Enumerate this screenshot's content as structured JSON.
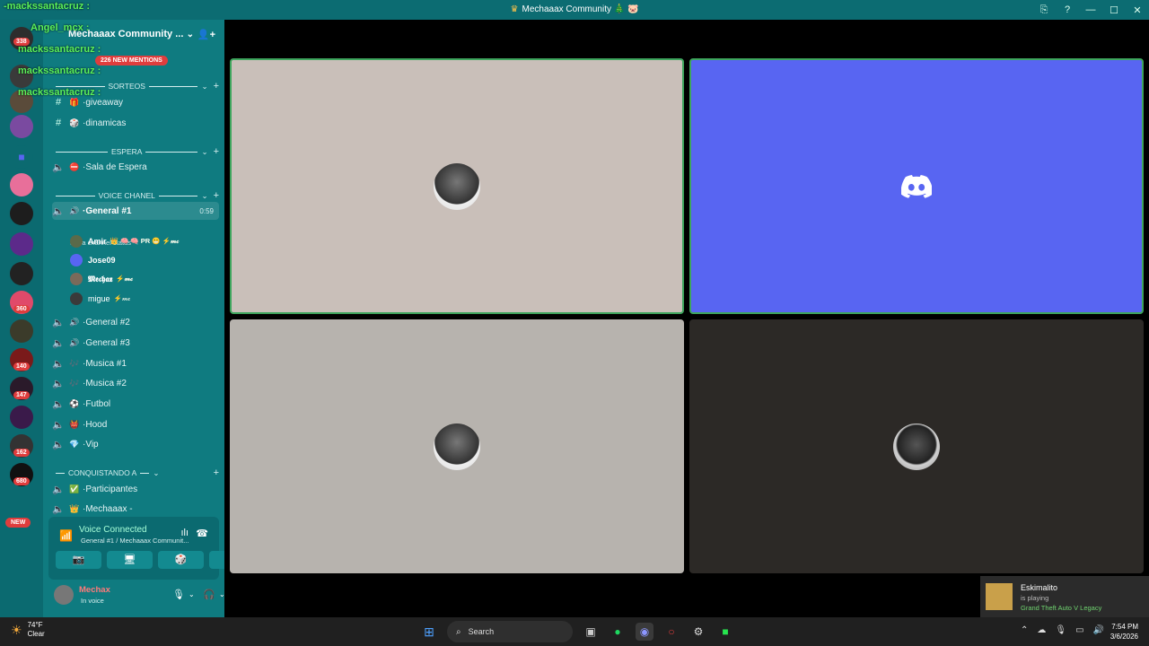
{
  "window": {
    "title": "Mechaaax Community",
    "title_emojis": "🎄 🐷",
    "controls": [
      "⎘",
      "?",
      "—",
      "☐",
      "✕"
    ]
  },
  "stream_overlay": {
    "lines": [
      "-mackssantacruz :",
      "Angel_mcx :",
      "mackssantacruz :",
      "mackssantacruz :",
      "mackssantacruz :"
    ]
  },
  "server": {
    "name": "Mechaaax Community ...",
    "mentions": "226 NEW MENTIONS"
  },
  "rail": {
    "badges": [
      "338",
      "360",
      "140",
      "147",
      "162",
      "680"
    ],
    "new_label": "NEW"
  },
  "categories": [
    {
      "name": "SORTEOS"
    },
    {
      "name": "ESPERA"
    },
    {
      "name": "VOICE CHANEL"
    },
    {
      "name": "CONQUISTANDO A"
    }
  ],
  "text_channels": [
    {
      "name": "giveaway",
      "emoji": "🎁"
    },
    {
      "name": "dinamicas",
      "emoji": "🎲"
    }
  ],
  "voice_channels": [
    {
      "name": "Sala de Espera",
      "emoji": "⛔"
    },
    {
      "name": "General #1",
      "emoji": "🔊",
      "timer": "0:59"
    },
    {
      "name": "General #2",
      "emoji": "🔊"
    },
    {
      "name": "General #3",
      "emoji": "🔊"
    },
    {
      "name": "Musica #1",
      "emoji": "🎶"
    },
    {
      "name": "Musica #2",
      "emoji": "🎶"
    },
    {
      "name": "Futbol",
      "emoji": "⚽"
    },
    {
      "name": "Hood",
      "emoji": "👹"
    },
    {
      "name": "Vip",
      "emoji": "💎"
    },
    {
      "name": "Participantes",
      "emoji": "✅"
    },
    {
      "name": "Mechaaax -",
      "emoji": "👑"
    }
  ],
  "channel_status_hint": "Set a channel status ✎",
  "members": [
    {
      "name": "Amir",
      "tag": "👑 🧠 🧠 PR 😬 ⚡𝓂𝒸"
    },
    {
      "name": "Jose09",
      "tag": ""
    },
    {
      "name": "𝕸𝖊𝖈𝖍𝖆𝖝",
      "tag": "⚡𝓂𝒸"
    },
    {
      "name": "migue",
      "tag": "⚡𝓂𝒸"
    }
  ],
  "voice_panel": {
    "title": "Voice Connected",
    "subtitle": "General #1 / Mechaaax Communit...",
    "buttons": [
      "📷",
      "🖥",
      "🎲",
      "🚀"
    ]
  },
  "user_panel": {
    "name": "Mechax",
    "status": "In voice"
  },
  "toast": {
    "name": "Eskimalito",
    "status": "is playing",
    "game": "Grand Theft Auto V Legacy"
  },
  "taskbar": {
    "temp": "74°F",
    "condition": "Clear",
    "search_placeholder": "Search",
    "time": "7:54 PM",
    "date": "3/6/2026"
  },
  "colors": {
    "sidebar": "#0f7b80",
    "rail": "#0b6a70",
    "tile1": "#c9bfb9",
    "tile2": "#5865f2",
    "tile3": "#b7b3ae",
    "tile4": "#2c2926",
    "speaking": "#3ea55d"
  }
}
